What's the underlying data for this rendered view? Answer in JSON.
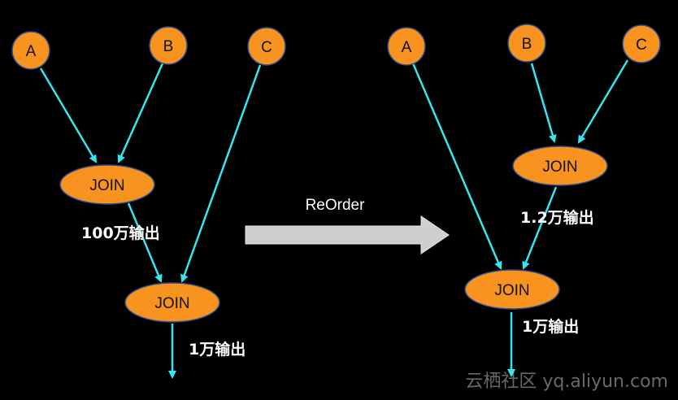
{
  "colors": {
    "background": "#000000",
    "node_fill": "#F7931E",
    "node_stroke": "#2B4C8C",
    "edge": "#33E6F0",
    "big_arrow": "#CFCFCF"
  },
  "left_tree": {
    "nodes": {
      "A": "A",
      "B": "B",
      "C": "C",
      "join1": "JOIN",
      "join2": "JOIN"
    },
    "annotations": {
      "join1_output": "100万输出",
      "join2_output": "1万输出"
    }
  },
  "transform": {
    "label": "ReOrder"
  },
  "right_tree": {
    "nodes": {
      "A": "A",
      "B": "B",
      "C": "C",
      "join1": "JOIN",
      "join2": "JOIN"
    },
    "annotations": {
      "join1_output": "1.2万输出",
      "join2_output": "1万输出"
    }
  },
  "watermark": "云栖社区 yq.aliyun.com"
}
